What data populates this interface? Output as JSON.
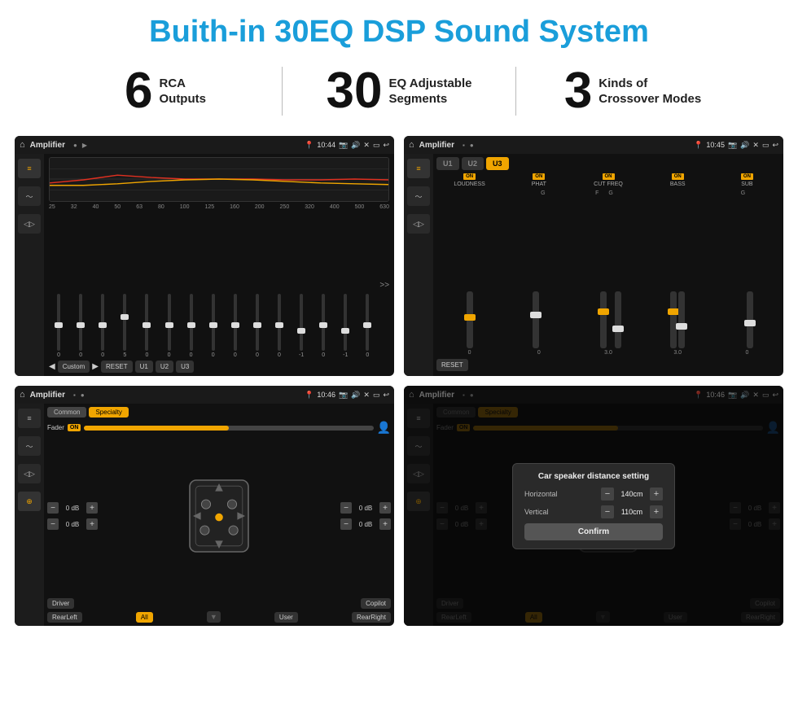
{
  "header": {
    "title": "Buith-in 30EQ DSP Sound System"
  },
  "stats": [
    {
      "number": "6",
      "label": "RCA\nOutputs"
    },
    {
      "number": "30",
      "label": "EQ Adjustable\nSegments"
    },
    {
      "number": "3",
      "label": "Kinds of\nCrossover Modes"
    }
  ],
  "screens": [
    {
      "id": "eq-screen",
      "topbar": {
        "title": "Amplifier",
        "time": "10:44"
      },
      "type": "eq",
      "eq_bands": [
        25,
        32,
        40,
        50,
        63,
        80,
        100,
        125,
        160,
        200,
        250,
        320,
        400,
        500,
        630
      ],
      "eq_values": [
        0,
        0,
        0,
        5,
        0,
        0,
        0,
        0,
        0,
        0,
        0,
        -1,
        0,
        -1
      ],
      "preset": "Custom",
      "buttons": [
        "RESET",
        "U1",
        "U2",
        "U3"
      ]
    },
    {
      "id": "crossover-screen",
      "topbar": {
        "title": "Amplifier",
        "time": "10:45"
      },
      "type": "crossover",
      "presets": [
        "U1",
        "U2",
        "U3"
      ],
      "active_preset": "U3",
      "channels": [
        "LOUDNESS",
        "PHAT",
        "CUT FREQ",
        "BASS",
        "SUB"
      ],
      "channel_on": [
        true,
        true,
        true,
        true,
        true
      ]
    },
    {
      "id": "fader-screen",
      "topbar": {
        "title": "Amplifier",
        "time": "10:46"
      },
      "type": "fader",
      "tabs": [
        "Common",
        "Specialty"
      ],
      "active_tab": "Specialty",
      "fader_label": "Fader",
      "fader_on": "ON",
      "positions": {
        "driver_db": "0 dB",
        "copilot_db": "0 dB",
        "rearleft_db": "0 dB",
        "rearright_db": "0 dB"
      },
      "bottom_buttons": [
        "Driver",
        "RearLeft",
        "All",
        "User",
        "RearRight",
        "Copilot"
      ]
    },
    {
      "id": "dialog-screen",
      "topbar": {
        "title": "Amplifier",
        "time": "10:46"
      },
      "type": "dialog",
      "dialog": {
        "title": "Car speaker distance setting",
        "horizontal_label": "Horizontal",
        "horizontal_value": "140cm",
        "vertical_label": "Vertical",
        "vertical_value": "110cm",
        "confirm_label": "Confirm"
      },
      "fader_label": "Fader",
      "fader_on": "ON",
      "positions": {
        "driver_db": "0 dB",
        "copilot_db": "0 dB",
        "rearleft_db": "",
        "rearright_db": "0 dB"
      }
    }
  ]
}
